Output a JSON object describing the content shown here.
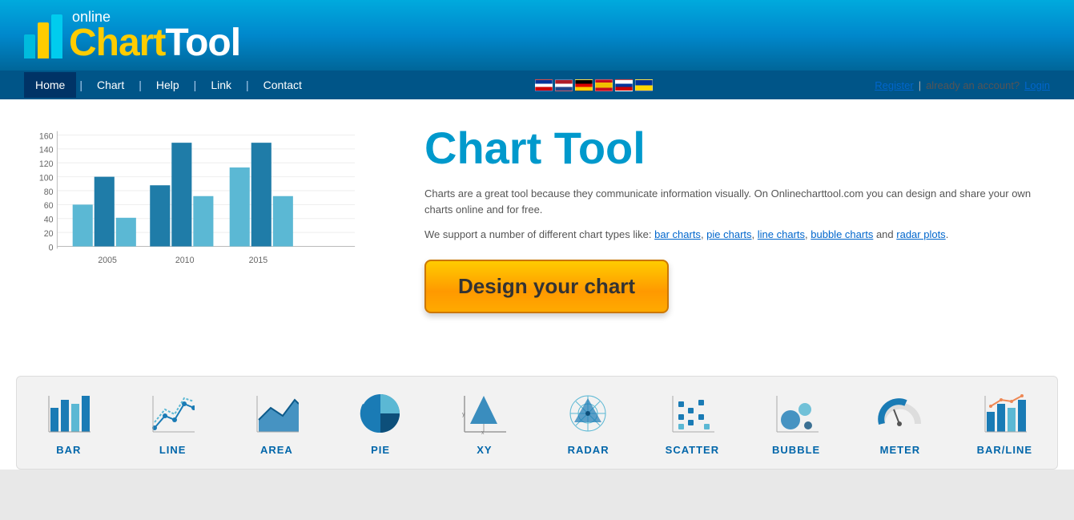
{
  "header": {
    "logo_online": "online",
    "logo_chart": "Chart",
    "logo_tool": "Tool"
  },
  "nav": {
    "items": [
      {
        "label": "Home",
        "active": true
      },
      {
        "label": "Chart",
        "active": false
      },
      {
        "label": "Help",
        "active": false
      },
      {
        "label": "Link",
        "active": false
      },
      {
        "label": "Contact",
        "active": false
      }
    ]
  },
  "auth": {
    "register": "Register",
    "separator": "|",
    "already": "already an account?",
    "login": "Login"
  },
  "main": {
    "title": "Chart Tool",
    "desc1": "Charts are a great tool because they communicate information visually. On Onlinecharttool.com you can design and share your own charts online and for free.",
    "desc2": "We support a number of different chart types like:",
    "link_bar": "bar charts",
    "link_pie": "pie charts",
    "link_line": "line charts",
    "link_bubble": "bubble charts",
    "link_radar": "radar plots",
    "desc2_mid": ", ",
    "desc2_and": " and ",
    "desc2_end": ".",
    "design_btn": "Design your chart"
  },
  "chart": {
    "y_labels": [
      160,
      140,
      120,
      100,
      80,
      60,
      40,
      20,
      0
    ],
    "x_labels": [
      "2005",
      "2010",
      "2015"
    ],
    "bars": [
      {
        "group": "2005",
        "v1": 60,
        "v2": 100,
        "v3": 46
      },
      {
        "group": "2010",
        "v1": 89,
        "v2": 149,
        "v3": 72
      },
      {
        "group": "2015",
        "v1": 113,
        "v2": 149,
        "v3": 72
      }
    ]
  },
  "chart_types": [
    {
      "label": "BAR",
      "icon": "bar"
    },
    {
      "label": "LINE",
      "icon": "line"
    },
    {
      "label": "AREA",
      "icon": "area"
    },
    {
      "label": "PIE",
      "icon": "pie"
    },
    {
      "label": "XY",
      "icon": "xy"
    },
    {
      "label": "RADAR",
      "icon": "radar"
    },
    {
      "label": "SCATTER",
      "icon": "scatter"
    },
    {
      "label": "BUBBLE",
      "icon": "bubble"
    },
    {
      "label": "METER",
      "icon": "meter"
    },
    {
      "label": "BAR/LINE",
      "icon": "barline"
    }
  ]
}
